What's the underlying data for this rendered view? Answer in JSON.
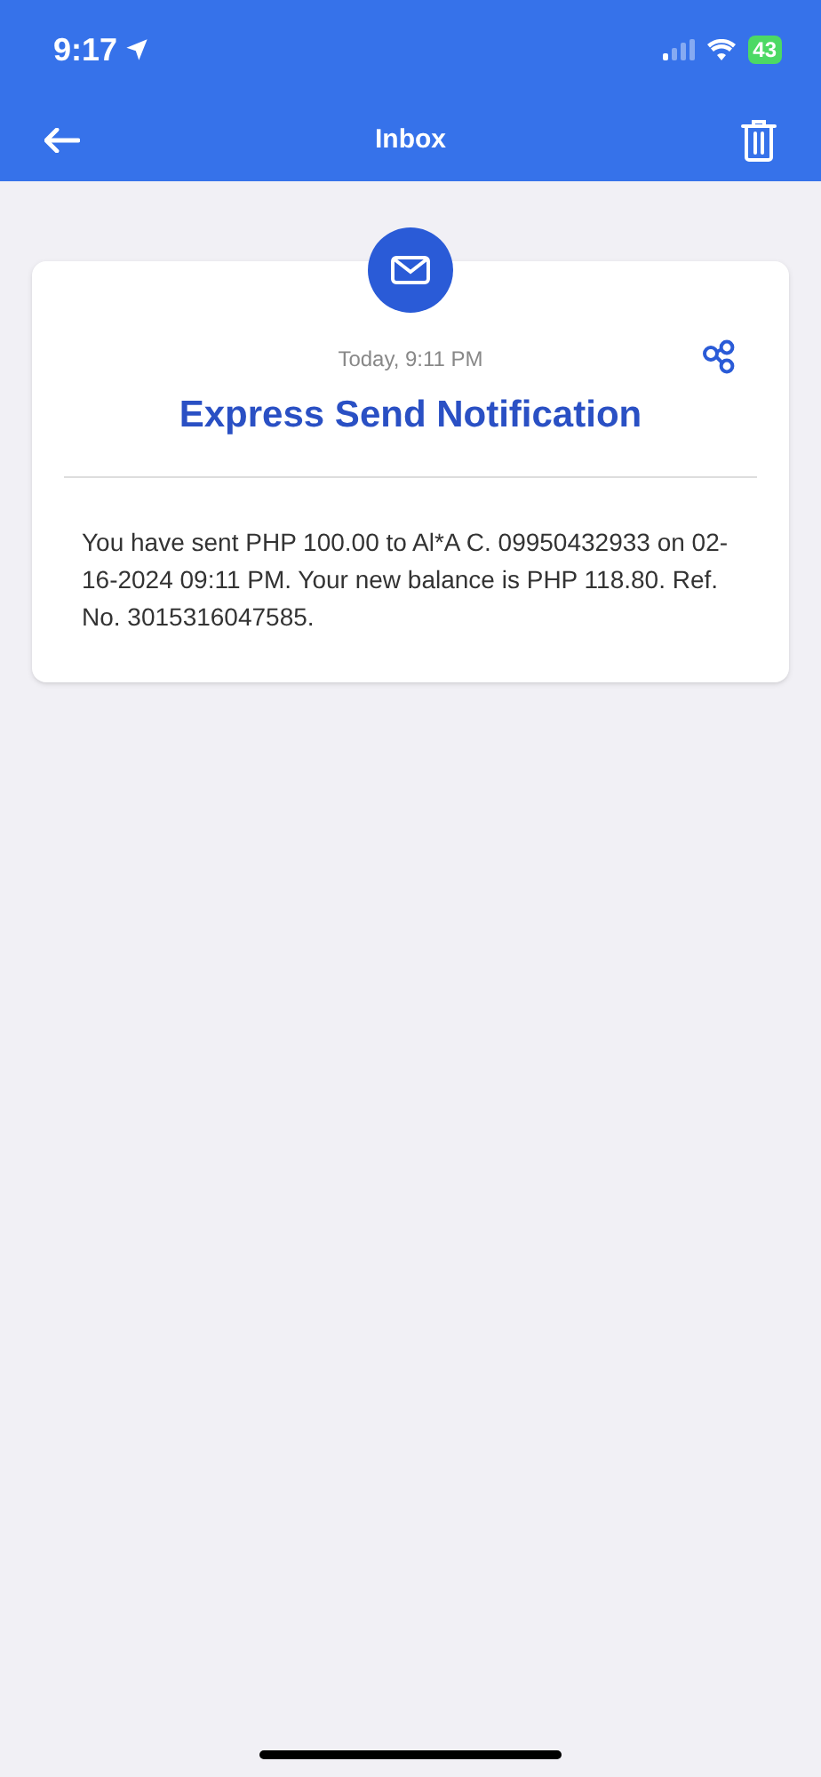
{
  "status_bar": {
    "time": "9:17",
    "battery": "43"
  },
  "header": {
    "title": "Inbox"
  },
  "message": {
    "timestamp": "Today, 9:11 PM",
    "title": "Express Send Notification",
    "body": "You have sent PHP 100.00 to Al*A C. 09950432933 on 02-16-2024 09:11 PM. Your new balance is PHP 118.80. Ref. No. 3015316047585."
  }
}
